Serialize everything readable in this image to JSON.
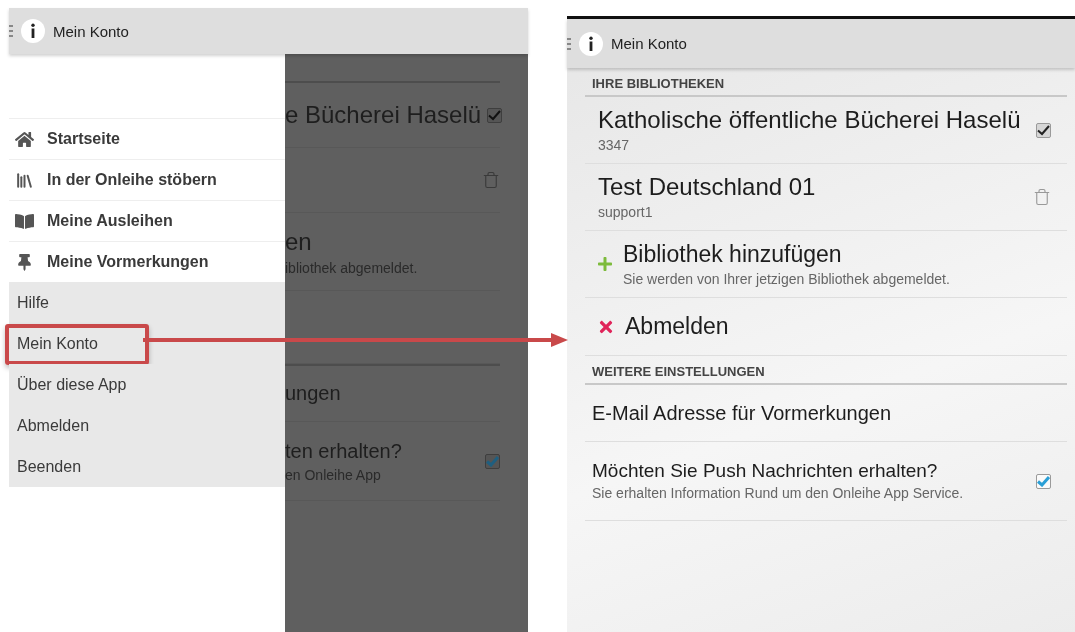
{
  "left_screen": {
    "app_bar": {
      "title": "Mein Konto"
    },
    "drawer": {
      "items": [
        {
          "label": "Startseite",
          "kind": "primary",
          "annotated": false
        },
        {
          "label": "In der Onleihe stöbern",
          "kind": "primary",
          "annotated": false
        },
        {
          "label": "Meine Ausleihen",
          "kind": "primary",
          "annotated": false
        },
        {
          "label": "Meine Vormerkungen",
          "kind": "primary",
          "annotated": false
        },
        {
          "label": "Hilfe",
          "kind": "secondary",
          "annotated": false
        },
        {
          "label": "Mein Konto",
          "kind": "secondary",
          "annotated": true
        },
        {
          "label": "Über diese App",
          "kind": "secondary",
          "annotated": false
        },
        {
          "label": "Abmelden",
          "kind": "secondary",
          "annotated": false
        },
        {
          "label": "Beenden",
          "kind": "secondary",
          "annotated": false
        }
      ]
    },
    "dimmed_content": {
      "sections": [
        {
          "items": [
            {
              "kind": "selectable",
              "title": "e Bücherei Haselü",
              "checked": true
            },
            {
              "kind": "delete"
            },
            {
              "kind": "add",
              "title": "en",
              "subtitle": "ibliothek abgemeldet."
            },
            {
              "kind": "logout"
            }
          ]
        },
        {
          "items": [
            {
              "kind": "plain",
              "title": "ungen"
            },
            {
              "kind": "checkbox",
              "title": "ten erhalten?",
              "subtitle": "en Onleihe App",
              "checked": true
            }
          ]
        }
      ]
    }
  },
  "right_screen": {
    "app_bar": {
      "title": "Mein Konto"
    },
    "sections": [
      {
        "heading": "IHRE BIBLIOTHEKEN",
        "items": [
          {
            "kind": "selectable",
            "title": "Katholische öffentliche Bücherei Haselü",
            "subtitle": "3347",
            "checked": true
          },
          {
            "kind": "delete",
            "title": "Test Deutschland 01",
            "subtitle": "support1"
          },
          {
            "kind": "add",
            "title": "Bibliothek hinzufügen",
            "subtitle": "Sie werden von Ihrer jetzigen Bibliothek abgemeldet."
          },
          {
            "kind": "logout",
            "title": "Abmelden"
          }
        ]
      },
      {
        "heading": "WEITERE EINSTELLUNGEN",
        "items": [
          {
            "kind": "plain",
            "title": "E-Mail Adresse für Vormerkungen"
          },
          {
            "kind": "checkbox",
            "title": "Möchten Sie Push Nachrichten erhalten?",
            "subtitle": "Sie erhalten Information Rund um den Onleihe App Service.",
            "checked": true
          }
        ]
      }
    ]
  }
}
